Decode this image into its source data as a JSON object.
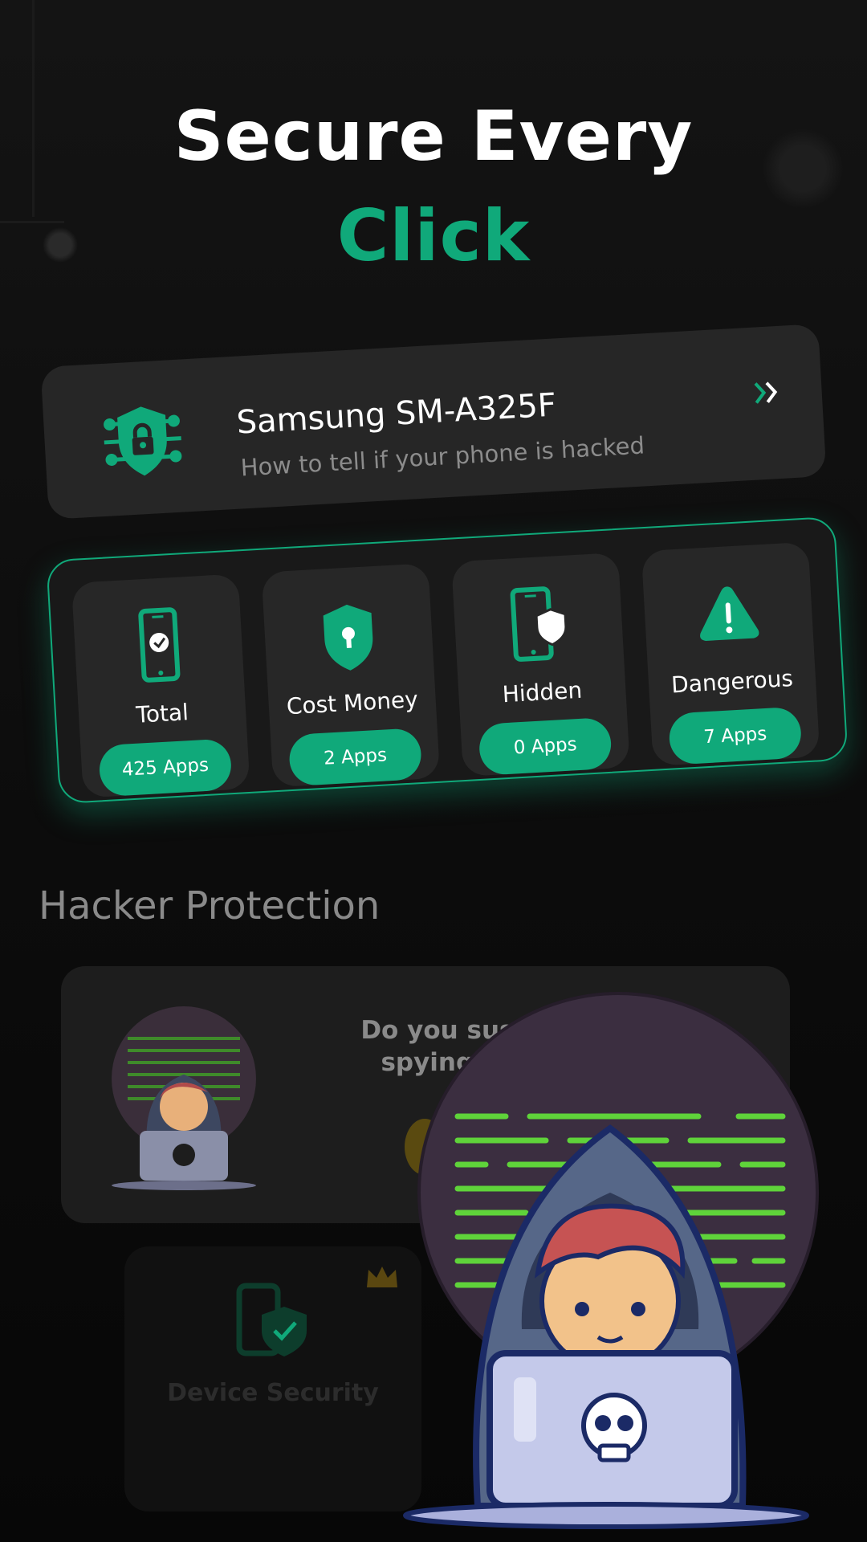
{
  "header": {
    "line1": "Secure Every",
    "line2": "Click"
  },
  "device": {
    "name": "Samsung SM-A325F",
    "subtitle": "How to tell if your phone is hacked"
  },
  "stats": [
    {
      "label": "Total",
      "button": "425 Apps",
      "icon": "phone-check-icon"
    },
    {
      "label": "Cost Money",
      "button": "2 Apps",
      "icon": "shield-keyhole-icon"
    },
    {
      "label": "Hidden",
      "button": "0 Apps",
      "icon": "phone-shield-icon"
    },
    {
      "label": "Dangerous",
      "button": "7 Apps",
      "icon": "warning-triangle-icon"
    }
  ],
  "section": {
    "title": "Hacker Protection"
  },
  "promo": {
    "line1": "Do you susp",
    "line2": "spying or"
  },
  "device_security": {
    "label": "Device Security",
    "badge": "crown-icon"
  },
  "colors": {
    "accent": "#10a97a",
    "background": "#0a0a0a",
    "card": "#262626"
  }
}
